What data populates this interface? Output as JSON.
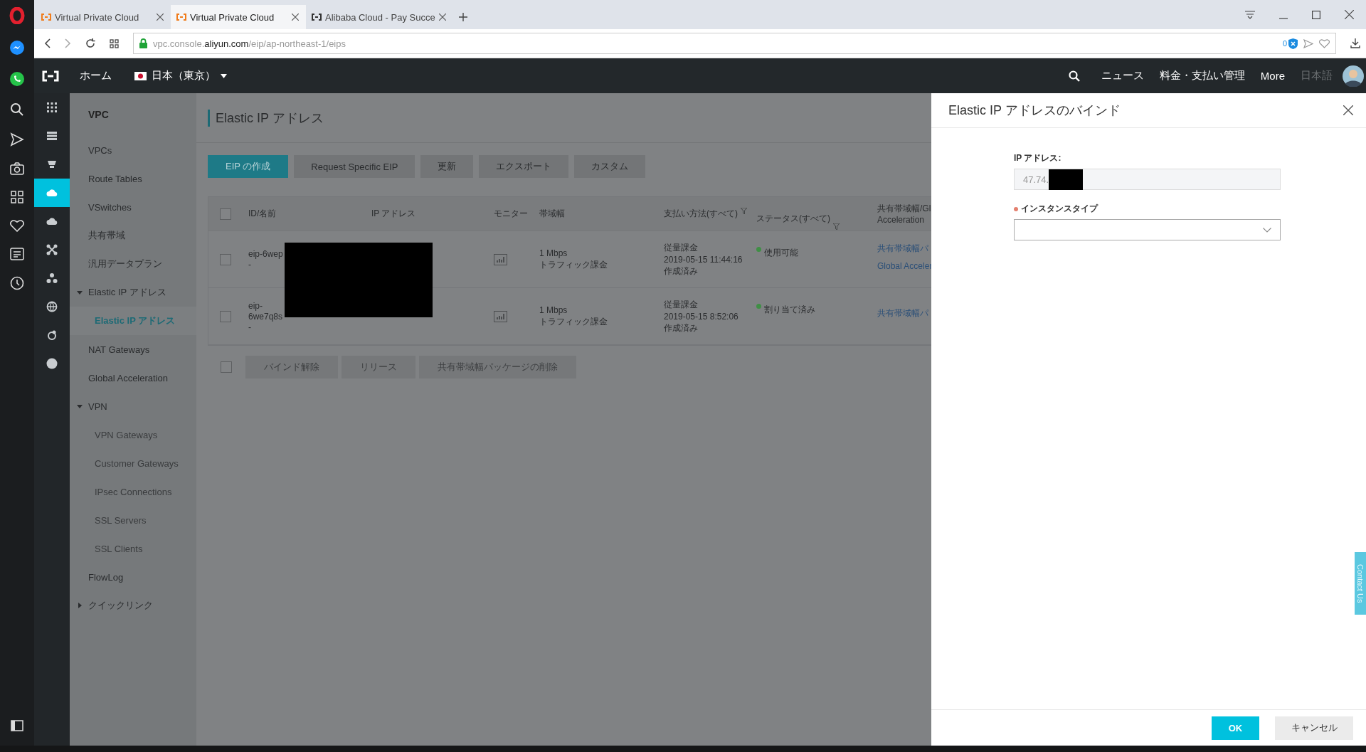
{
  "browser": {
    "tabs": [
      {
        "title": "Virtual Private Cloud",
        "selected": false
      },
      {
        "title": "Virtual Private Cloud",
        "selected": true
      },
      {
        "title": "Alibaba Cloud - Pay Succe",
        "selected": false
      }
    ],
    "url": {
      "subdomain": "vpc.console.",
      "domain": "aliyun.com",
      "path": "/eip/ap-northeast-1/eips"
    },
    "blocked_count": "0"
  },
  "topnav": {
    "home": "ホーム",
    "region": "日本（東京）",
    "links": [
      "ニュース",
      "料金・支払い管理",
      "More"
    ],
    "language": "日本語"
  },
  "rail": [
    {
      "selected": false
    },
    {
      "selected": false
    },
    {
      "selected": false
    },
    {
      "selected": true
    },
    {
      "selected": false
    },
    {
      "selected": false
    },
    {
      "selected": false
    },
    {
      "selected": false
    },
    {
      "selected": false
    },
    {
      "selected": false
    }
  ],
  "sidebar": {
    "title": "VPC",
    "items": [
      {
        "label": "VPCs"
      },
      {
        "label": "Route Tables"
      },
      {
        "label": "VSwitches"
      },
      {
        "label": "共有帯域"
      },
      {
        "label": "汎用データプラン"
      },
      {
        "label": "Elastic IP アドレス",
        "expanded": true,
        "children": [
          {
            "label": "Elastic IP アドレス",
            "selected": true
          }
        ]
      },
      {
        "label": "NAT Gateways"
      },
      {
        "label": "Global Acceleration"
      },
      {
        "label": "VPN",
        "expanded": true,
        "children": [
          {
            "label": "VPN Gateways",
            "selected": false
          },
          {
            "label": "Customer Gateways",
            "selected": false
          },
          {
            "label": "IPsec Connections",
            "selected": false
          },
          {
            "label": "SSL Servers",
            "selected": false
          },
          {
            "label": "SSL Clients",
            "selected": false
          }
        ]
      },
      {
        "label": "FlowLog"
      },
      {
        "label": "クイックリンク",
        "expanded": false
      }
    ]
  },
  "main": {
    "title": "Elastic IP アドレス",
    "toolbar": [
      {
        "label": "EIP の作成",
        "kind": "primary"
      },
      {
        "label": "Request Specific EIP",
        "kind": "default"
      },
      {
        "label": "更新",
        "kind": "default"
      },
      {
        "label": "エクスポート",
        "kind": "default"
      },
      {
        "label": "カスタム",
        "kind": "default"
      }
    ],
    "table": {
      "all_checked": false,
      "columns": [
        {
          "lines": [
            "ID/名前"
          ],
          "filter": false
        },
        {
          "lines": [
            "IP アドレス"
          ],
          "filter": false
        },
        {
          "lines": [
            "モニター"
          ],
          "filter": false
        },
        {
          "lines": [
            "帯域幅"
          ],
          "filter": false
        },
        {
          "lines": [
            "支払い方法(すべて)"
          ],
          "filter": true
        },
        {
          "lines": [
            "ステータス(すべて)"
          ],
          "filter": true
        },
        {
          "lines": [
            "共有帯域幅/Gl",
            "Acceleration"
          ],
          "filter": false
        }
      ],
      "rows": [
        {
          "checked": false,
          "id": [
            "eip-6wep",
            "-"
          ],
          "bandwidth": [
            "1 Mbps",
            "トラフィック課金"
          ],
          "payment": [
            "従量課金",
            "2019-05-15 11:44:16",
            "作成済み"
          ],
          "status": {
            "text": "使用可能",
            "color": "#3f8f45"
          },
          "links": [
            "共有帯域幅パ",
            "Global Acceler"
          ]
        },
        {
          "checked": false,
          "id": [
            "eip-",
            "6we7q8s",
            "-"
          ],
          "bandwidth": [
            "1 Mbps",
            "トラフィック課金"
          ],
          "payment": [
            "従量課金",
            "2019-05-15 8:52:06",
            "作成済み"
          ],
          "status": {
            "text": "割り当て済み",
            "color": "#3f8f45"
          },
          "links": [
            "共有帯域幅パ"
          ]
        }
      ]
    },
    "bulk": {
      "checked": false,
      "buttons": [
        {
          "label": "バインド解除",
          "disabled": true
        },
        {
          "label": "リリース",
          "disabled": true
        },
        {
          "label": "共有帯域幅パッケージの削除",
          "disabled": true
        }
      ]
    }
  },
  "drawer": {
    "title": "Elastic IP アドレスのバインド",
    "fields": [
      {
        "kind": "readonly",
        "label": "IP アドレス:",
        "required": false,
        "value": "47.74."
      },
      {
        "kind": "select",
        "label": "インスタンスタイプ",
        "required": true
      }
    ],
    "buttons": [
      {
        "label": "OK",
        "kind": "primary"
      },
      {
        "label": "キャンセル",
        "kind": "default"
      }
    ],
    "contact_tab": "Contact Us"
  }
}
